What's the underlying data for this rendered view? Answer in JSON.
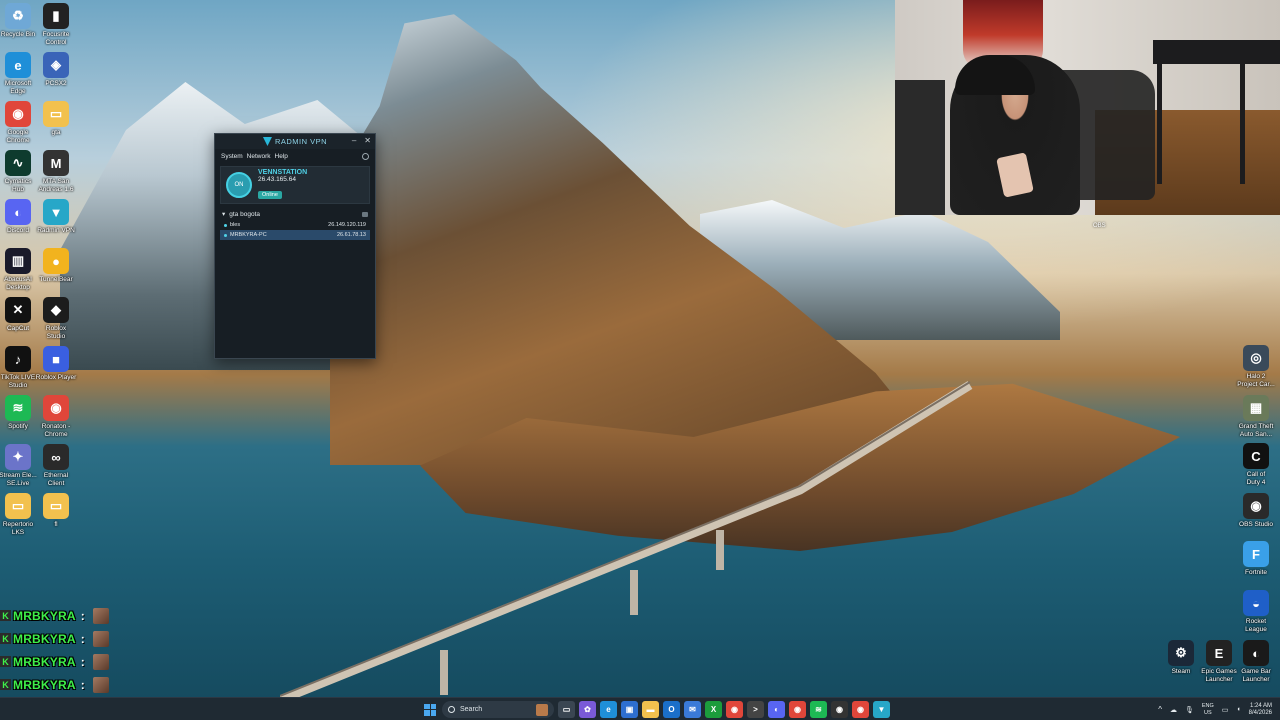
{
  "desktop_icons_left": [
    {
      "label": "Recycle Bin",
      "icon": "recycle-bin-icon",
      "color": "#6fa8d6",
      "glyph": "♻"
    },
    {
      "label": "Focusrite\nControl",
      "icon": "focusrite-icon",
      "color": "#222222",
      "glyph": "▮"
    },
    {
      "label": "Microsoft\nEdge",
      "icon": "edge-icon",
      "color": "#1f8fd8",
      "glyph": "e"
    },
    {
      "label": "PCSX2",
      "icon": "pcsx2-icon",
      "color": "#3a64b8",
      "glyph": "◈"
    },
    {
      "label": "Google\nChrome",
      "icon": "chrome-icon",
      "color": "#e0463a",
      "glyph": "◉"
    },
    {
      "label": "gta",
      "icon": "folder-icon",
      "color": "#f2c14e",
      "glyph": "▭"
    },
    {
      "label": "Cymatics\nHub",
      "icon": "cymatics-icon",
      "color": "#0e3b2e",
      "glyph": "∿"
    },
    {
      "label": "MTA San\nAndreas 1.6",
      "icon": "mta-icon",
      "color": "#333333",
      "glyph": "M"
    },
    {
      "label": "Discord",
      "icon": "discord-icon",
      "color": "#5865f2",
      "glyph": "◐"
    },
    {
      "label": "Radmin VPN",
      "icon": "radmin-icon",
      "color": "#27a7c8",
      "glyph": "▼"
    },
    {
      "label": "AbacusAI\nDesktop",
      "icon": "abacus-icon",
      "color": "#1a1a2a",
      "glyph": "▥"
    },
    {
      "label": "TunnelBear",
      "icon": "tunnelbear-icon",
      "color": "#f2b31e",
      "glyph": "●"
    },
    {
      "label": "CapCut",
      "icon": "capcut-icon",
      "color": "#111111",
      "glyph": "✕"
    },
    {
      "label": "Roblox\nStudio",
      "icon": "roblox-studio-icon",
      "color": "#1c1c1c",
      "glyph": "◆"
    },
    {
      "label": "TikTok LIVE\nStudio",
      "icon": "tiktok-icon",
      "color": "#111111",
      "glyph": "♪"
    },
    {
      "label": "Roblox Player",
      "icon": "roblox-player-icon",
      "color": "#3a5fe0",
      "glyph": "■"
    },
    {
      "label": "Spotify",
      "icon": "spotify-icon",
      "color": "#1db954",
      "glyph": "≋"
    },
    {
      "label": "Ronaton -\nChrome",
      "icon": "chrome-icon",
      "color": "#e0463a",
      "glyph": "◉"
    },
    {
      "label": "Stream Ele...\nSE.Live",
      "icon": "streamelements-icon",
      "color": "#6b74c9",
      "glyph": "✦"
    },
    {
      "label": "Ethernal\nClient",
      "icon": "ethernal-icon",
      "color": "#2a2a2a",
      "glyph": "∞"
    },
    {
      "label": "Repertorio\nLKS",
      "icon": "folder-icon",
      "color": "#f2c14e",
      "glyph": "▭"
    },
    {
      "label": "fl",
      "icon": "folder-icon",
      "color": "#f2c14e",
      "glyph": "▭"
    }
  ],
  "desktop_icons_right": [
    {
      "label": "Halo 2\nProject Car...",
      "icon": "halo-icon",
      "color": "#3a4a5a",
      "glyph": "◎"
    },
    {
      "label": "Grand Theft\nAuto San...",
      "icon": "gta-sa-icon",
      "color": "#6a7a5a",
      "glyph": "▦"
    },
    {
      "label": "Call of\nDuty 4",
      "icon": "cod-icon",
      "color": "#111111",
      "glyph": "C"
    },
    {
      "label": "OBS Studio",
      "icon": "obs-icon",
      "color": "#2a2a2a",
      "glyph": "◉"
    },
    {
      "label": "Fortnite",
      "icon": "fortnite-icon",
      "color": "#3aa0e8",
      "glyph": "F"
    },
    {
      "label": "Rocket\nLeague",
      "icon": "rocket-league-icon",
      "color": "#1f5fc8",
      "glyph": "◒"
    },
    {
      "label": "Steam",
      "icon": "steam-icon",
      "color": "#1b2838",
      "glyph": "⚙"
    },
    {
      "label": "Epic Games\nLauncher",
      "icon": "epic-icon",
      "color": "#222222",
      "glyph": "E"
    },
    {
      "label": "Game Bar\nLauncher",
      "icon": "gamebar-icon",
      "color": "#1a1a1a",
      "glyph": "◐"
    }
  ],
  "radmin": {
    "title": "RADMIN VPN",
    "menu": [
      "System",
      "Network",
      "Help"
    ],
    "self_name": "VENNSTATION",
    "self_ip": "26.43.165.64",
    "power_label": "ON",
    "status": "Online",
    "network_name": "gta bogota",
    "peers": [
      {
        "name": "bles",
        "ip": "26.149.120.119",
        "selected": false
      },
      {
        "name": "MRBKYRA-PC",
        "ip": "26.61.78.13",
        "selected": true
      }
    ]
  },
  "webcam_label": "OBS",
  "chat": {
    "lines": [
      {
        "name": "MRBKYRA",
        "sep": ":"
      },
      {
        "name": "MRBKYRA",
        "sep": ":"
      },
      {
        "name": "MRBKYRA",
        "sep": ":"
      },
      {
        "name": "MRBKYRA",
        "sep": ":"
      },
      {
        "name": "MRBKYRA",
        "sep": ":"
      }
    ],
    "badge": "K",
    "name_color": "#3ef04a"
  },
  "taskbar": {
    "search_placeholder": "Search",
    "apps": [
      {
        "icon": "task-view-icon",
        "color": "#3a4652",
        "glyph": "▭"
      },
      {
        "icon": "copilot-icon",
        "color": "#7a5ad8",
        "glyph": "✿"
      },
      {
        "icon": "edge-icon",
        "color": "#1f8fd8",
        "glyph": "e"
      },
      {
        "icon": "store-icon",
        "color": "#2e6fd0",
        "glyph": "▣"
      },
      {
        "icon": "file-explorer-icon",
        "color": "#f2c14e",
        "glyph": "▬"
      },
      {
        "icon": "outlook-icon",
        "color": "#1b6fc8",
        "glyph": "O"
      },
      {
        "icon": "mail-icon",
        "color": "#3a7ad8",
        "glyph": "✉"
      },
      {
        "icon": "xbox-icon",
        "color": "#1c9c3c",
        "glyph": "X"
      },
      {
        "icon": "chrome-icon",
        "color": "#e0463a",
        "glyph": "◉"
      },
      {
        "icon": "terminal-icon",
        "color": "#444444",
        "glyph": ">"
      },
      {
        "icon": "discord-icon",
        "color": "#5865f2",
        "glyph": "◐"
      },
      {
        "icon": "chrome-icon",
        "color": "#e0463a",
        "glyph": "◉"
      },
      {
        "icon": "spotify-icon",
        "color": "#1db954",
        "glyph": "≋"
      },
      {
        "icon": "obs-icon",
        "color": "#333333",
        "glyph": "◉"
      },
      {
        "icon": "chrome-icon",
        "color": "#e0463a",
        "glyph": "◉"
      },
      {
        "icon": "radmin-icon",
        "color": "#27a7c8",
        "glyph": "▼"
      }
    ],
    "tray": {
      "lang_top": "ENG",
      "lang_bottom": "US",
      "time": "1:24 AM",
      "date": "8/4/2026"
    }
  }
}
